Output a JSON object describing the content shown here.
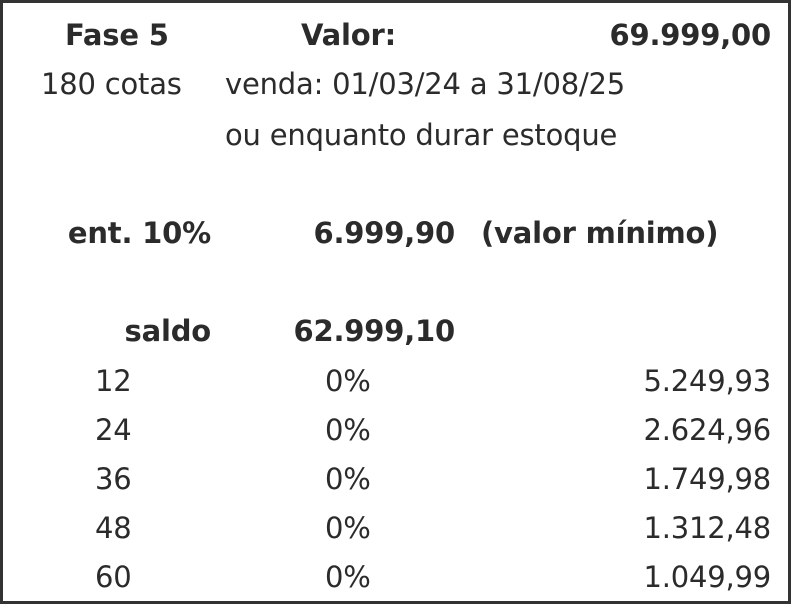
{
  "header": {
    "fase": "Fase 5",
    "valor_label": "Valor:",
    "valor": "69.999,00"
  },
  "info": {
    "cotas": "180 cotas",
    "venda": "venda: 01/03/24 a 31/08/25",
    "estoque": "ou enquanto durar estoque"
  },
  "entrada": {
    "label": "ent. 10%",
    "value": "6.999,90",
    "note": "(valor mínimo)"
  },
  "saldo": {
    "label": "saldo",
    "value": "62.999,10"
  },
  "installments": [
    {
      "months": "12",
      "rate": "0%",
      "amount": "5.249,93"
    },
    {
      "months": "24",
      "rate": "0%",
      "amount": "2.624,96"
    },
    {
      "months": "36",
      "rate": "0%",
      "amount": "1.749,98"
    },
    {
      "months": "48",
      "rate": "0%",
      "amount": "1.312,48"
    },
    {
      "months": "60",
      "rate": "0%",
      "amount": "1.049,99"
    }
  ]
}
